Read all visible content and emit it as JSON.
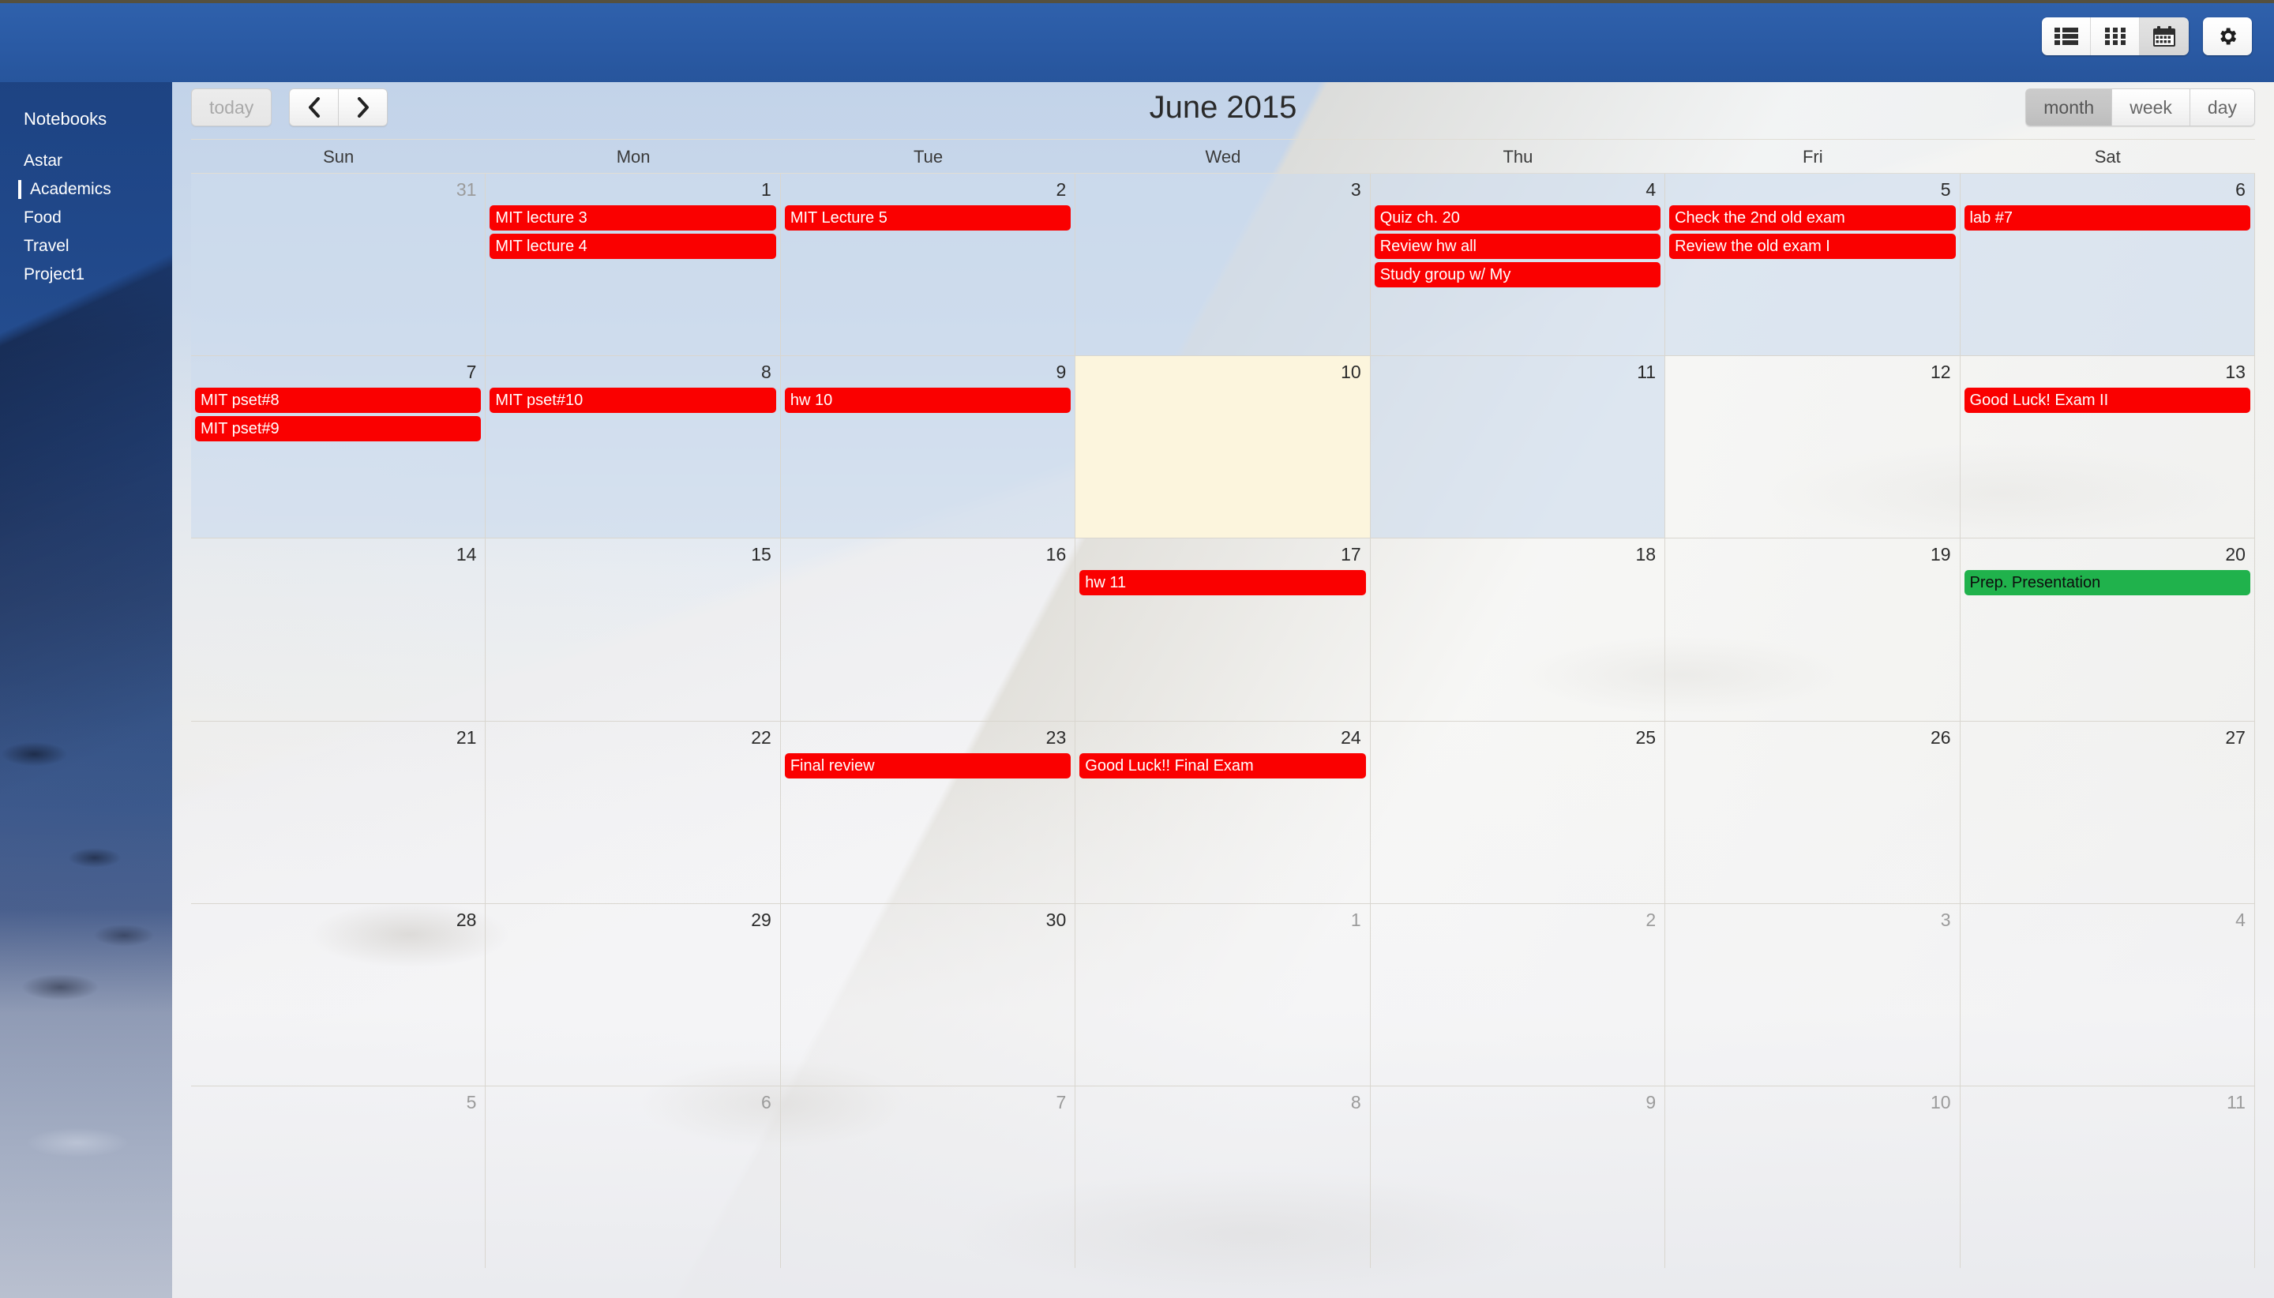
{
  "app": {
    "brand": "Academics"
  },
  "toolbar": {
    "view_buttons": [
      {
        "name": "list-view-button",
        "icon": "list-icon",
        "active": false
      },
      {
        "name": "grid-view-button",
        "icon": "grid-icon",
        "active": false
      },
      {
        "name": "calendar-view-button",
        "icon": "calendar-icon",
        "active": true
      }
    ],
    "settings": {
      "name": "settings-button",
      "icon": "gear-icon"
    }
  },
  "sidebar": {
    "title": "Notebooks",
    "items": [
      {
        "label": "Astar",
        "selected": false,
        "child": false
      },
      {
        "label": "Academics",
        "selected": true,
        "child": true
      },
      {
        "label": "Food",
        "selected": false,
        "child": false
      },
      {
        "label": "Travel",
        "selected": false,
        "child": false
      },
      {
        "label": "Project1",
        "selected": false,
        "child": false
      }
    ]
  },
  "calendar": {
    "title": "June 2015",
    "today_label": "today",
    "prev_label": "‹",
    "next_label": "›",
    "views": [
      {
        "label": "month",
        "active": true
      },
      {
        "label": "week",
        "active": false
      },
      {
        "label": "day",
        "active": false
      }
    ],
    "day_headers": [
      "Sun",
      "Mon",
      "Tue",
      "Wed",
      "Thu",
      "Fri",
      "Sat"
    ],
    "colors": {
      "event_red": "#fa0000",
      "event_green": "#20b24c",
      "today_bg": "#fcf5dd",
      "brand_blue": "#2a5aa4"
    },
    "weeks": [
      [
        {
          "num": "31",
          "other": true,
          "today": false,
          "tint": true,
          "events": []
        },
        {
          "num": "1",
          "other": false,
          "today": false,
          "tint": true,
          "events": [
            {
              "title": "MIT lecture 3",
              "color": "red"
            },
            {
              "title": "MIT lecture 4",
              "color": "red"
            }
          ]
        },
        {
          "num": "2",
          "other": false,
          "today": false,
          "tint": true,
          "events": [
            {
              "title": "MIT Lecture 5",
              "color": "red"
            }
          ]
        },
        {
          "num": "3",
          "other": false,
          "today": false,
          "tint": true,
          "events": []
        },
        {
          "num": "4",
          "other": false,
          "today": false,
          "tint": true,
          "events": [
            {
              "title": "Quiz ch. 20",
              "color": "red"
            },
            {
              "title": "Review hw all",
              "color": "red"
            },
            {
              "title": "Study group w/ My",
              "color": "red"
            }
          ]
        },
        {
          "num": "5",
          "other": false,
          "today": false,
          "tint": true,
          "events": [
            {
              "title": "Check the 2nd old exam",
              "color": "red"
            },
            {
              "title": "Review the old exam I",
              "color": "red"
            }
          ]
        },
        {
          "num": "6",
          "other": false,
          "today": false,
          "tint": true,
          "events": [
            {
              "title": "lab #7",
              "color": "red"
            }
          ]
        }
      ],
      [
        {
          "num": "7",
          "other": false,
          "today": false,
          "tint": true,
          "events": [
            {
              "title": "MIT pset#8",
              "color": "red"
            },
            {
              "title": "MIT pset#9",
              "color": "red"
            }
          ]
        },
        {
          "num": "8",
          "other": false,
          "today": false,
          "tint": true,
          "events": [
            {
              "title": "MIT pset#10",
              "color": "red"
            }
          ]
        },
        {
          "num": "9",
          "other": false,
          "today": false,
          "tint": true,
          "events": [
            {
              "title": "hw 10",
              "color": "red"
            }
          ]
        },
        {
          "num": "10",
          "other": false,
          "today": true,
          "tint": false,
          "events": []
        },
        {
          "num": "11",
          "other": false,
          "today": false,
          "tint": true,
          "events": []
        },
        {
          "num": "12",
          "other": false,
          "today": false,
          "tint": false,
          "events": []
        },
        {
          "num": "13",
          "other": false,
          "today": false,
          "tint": false,
          "events": [
            {
              "title": "Good Luck! Exam II",
              "color": "red"
            }
          ]
        }
      ],
      [
        {
          "num": "14",
          "other": false,
          "today": false,
          "tint": false,
          "events": []
        },
        {
          "num": "15",
          "other": false,
          "today": false,
          "tint": false,
          "events": []
        },
        {
          "num": "16",
          "other": false,
          "today": false,
          "tint": false,
          "events": []
        },
        {
          "num": "17",
          "other": false,
          "today": false,
          "tint": false,
          "events": [
            {
              "title": "hw 11",
              "color": "red"
            }
          ]
        },
        {
          "num": "18",
          "other": false,
          "today": false,
          "tint": false,
          "events": []
        },
        {
          "num": "19",
          "other": false,
          "today": false,
          "tint": false,
          "events": []
        },
        {
          "num": "20",
          "other": false,
          "today": false,
          "tint": false,
          "events": [
            {
              "title": "Prep. Presentation",
              "color": "green"
            }
          ]
        }
      ],
      [
        {
          "num": "21",
          "other": false,
          "today": false,
          "tint": false,
          "events": []
        },
        {
          "num": "22",
          "other": false,
          "today": false,
          "tint": false,
          "events": []
        },
        {
          "num": "23",
          "other": false,
          "today": false,
          "tint": false,
          "events": [
            {
              "title": "Final review",
              "color": "red"
            }
          ]
        },
        {
          "num": "24",
          "other": false,
          "today": false,
          "tint": false,
          "events": [
            {
              "title": "Good Luck!! Final Exam",
              "color": "red"
            }
          ]
        },
        {
          "num": "25",
          "other": false,
          "today": false,
          "tint": false,
          "events": []
        },
        {
          "num": "26",
          "other": false,
          "today": false,
          "tint": false,
          "events": []
        },
        {
          "num": "27",
          "other": false,
          "today": false,
          "tint": false,
          "events": []
        }
      ],
      [
        {
          "num": "28",
          "other": false,
          "today": false,
          "tint": false,
          "events": []
        },
        {
          "num": "29",
          "other": false,
          "today": false,
          "tint": false,
          "events": []
        },
        {
          "num": "30",
          "other": false,
          "today": false,
          "tint": false,
          "events": []
        },
        {
          "num": "1",
          "other": true,
          "today": false,
          "tint": false,
          "events": []
        },
        {
          "num": "2",
          "other": true,
          "today": false,
          "tint": false,
          "events": []
        },
        {
          "num": "3",
          "other": true,
          "today": false,
          "tint": false,
          "events": []
        },
        {
          "num": "4",
          "other": true,
          "today": false,
          "tint": false,
          "events": []
        }
      ],
      [
        {
          "num": "5",
          "other": true,
          "today": false,
          "tint": false,
          "events": []
        },
        {
          "num": "6",
          "other": true,
          "today": false,
          "tint": false,
          "events": []
        },
        {
          "num": "7",
          "other": true,
          "today": false,
          "tint": false,
          "events": []
        },
        {
          "num": "8",
          "other": true,
          "today": false,
          "tint": false,
          "events": []
        },
        {
          "num": "9",
          "other": true,
          "today": false,
          "tint": false,
          "events": []
        },
        {
          "num": "10",
          "other": true,
          "today": false,
          "tint": false,
          "events": []
        },
        {
          "num": "11",
          "other": true,
          "today": false,
          "tint": false,
          "events": []
        }
      ]
    ]
  }
}
